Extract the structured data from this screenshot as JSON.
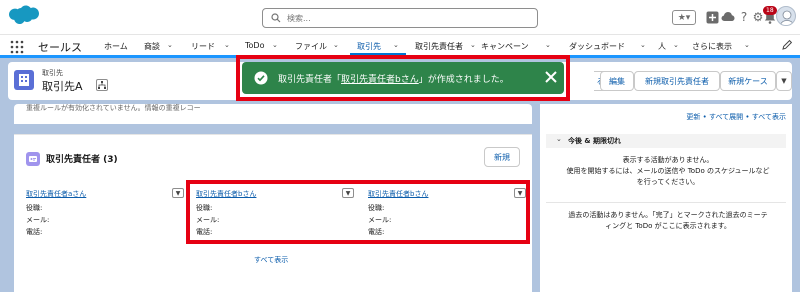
{
  "header": {
    "search_placeholder": "検索...",
    "notification_count": "18"
  },
  "nav": {
    "app_name": "セールス",
    "items": [
      {
        "label": "ホーム"
      },
      {
        "label": "商談"
      },
      {
        "label": "リード"
      },
      {
        "label": "ToDo"
      },
      {
        "label": "ファイル"
      },
      {
        "label": "取引先"
      },
      {
        "label": "取引先責任者"
      },
      {
        "label": "キャンペーン"
      },
      {
        "label": "ダッシュボード"
      },
      {
        "label": "人"
      },
      {
        "label": "さらに表示"
      }
    ]
  },
  "record": {
    "object_label": "取引先",
    "title": "取引先A",
    "buttons": {
      "partial": "る",
      "edit": "編集",
      "new_contact": "新規取引先責任者",
      "new_case": "新規ケース"
    }
  },
  "toast": {
    "prefix": "取引先責任者「",
    "link": "取引先責任者bさん",
    "suffix": "」が作成されました。"
  },
  "main": {
    "cut_text": "重複ルールが有効化されていません。情報の重複レコー",
    "related": {
      "title": "取引先責任者 (3)",
      "new_button": "新規",
      "field_labels": {
        "title": "役職:",
        "email": "メール:",
        "phone": "電話:"
      },
      "contacts": [
        {
          "name": "取引先責任者aさん"
        },
        {
          "name": "取引先責任者bさん"
        },
        {
          "name": "取引先責任者bさん"
        }
      ],
      "view_all": "すべて表示"
    }
  },
  "activity": {
    "links": "更新 • すべて展開 • すべて表示",
    "section_title": "今後 & 期限切れ",
    "empty_line1": "表示する活動がありません。",
    "empty_line2": "使用を開始するには、メールの送信や ToDo のスケジュールなど",
    "empty_line3": "を行ってください。",
    "past_line1": "過去の活動はありません。「完了」とマークされた過去のミーテ",
    "past_line2": "ィングと ToDo がここに表示されます。"
  },
  "colors": {
    "brand": "#0176d3",
    "toast_success": "#2e844a",
    "highlight": "#e60012",
    "background": "#b0c4df"
  }
}
